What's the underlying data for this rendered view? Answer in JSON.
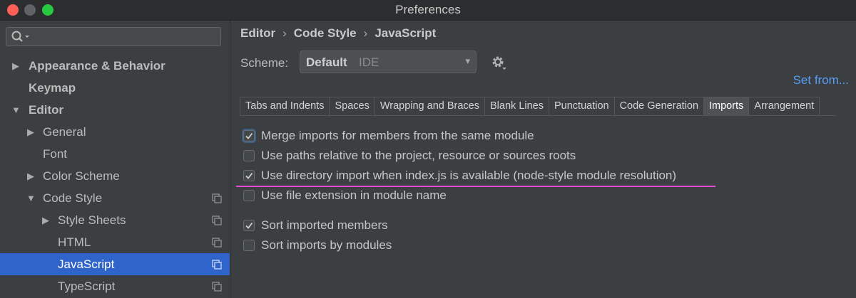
{
  "window": {
    "title": "Preferences"
  },
  "sidebar": {
    "search": {
      "value": "",
      "placeholder": ""
    },
    "items": [
      {
        "label": "Appearance & Behavior",
        "expandable": true,
        "expanded": false
      },
      {
        "label": "Keymap"
      },
      {
        "label": "Editor",
        "expandable": true,
        "expanded": true
      },
      {
        "label": "General",
        "expandable": true,
        "expanded": false
      },
      {
        "label": "Font"
      },
      {
        "label": "Color Scheme",
        "expandable": true,
        "expanded": false
      },
      {
        "label": "Code Style",
        "expandable": true,
        "expanded": true
      },
      {
        "label": "Style Sheets",
        "expandable": true,
        "expanded": false
      },
      {
        "label": "HTML"
      },
      {
        "label": "JavaScript",
        "selected": true
      },
      {
        "label": "TypeScript"
      }
    ]
  },
  "main": {
    "breadcrumb": [
      "Editor",
      "Code Style",
      "JavaScript"
    ],
    "breadcrumb_separator": "›",
    "scheme": {
      "label": "Scheme:",
      "name": "Default",
      "type": "IDE"
    },
    "set_from": "Set from...",
    "tabs": [
      {
        "label": "Tabs and Indents"
      },
      {
        "label": "Spaces"
      },
      {
        "label": "Wrapping and Braces"
      },
      {
        "label": "Blank Lines"
      },
      {
        "label": "Punctuation"
      },
      {
        "label": "Code Generation"
      },
      {
        "label": "Imports",
        "active": true
      },
      {
        "label": "Arrangement"
      }
    ],
    "options": [
      {
        "label": "Merge imports for members from the same module",
        "checked": true
      },
      {
        "label": "Use paths relative to the project, resource or sources roots",
        "checked": false
      },
      {
        "label": "Use directory import when index.js is available (node-style module resolution)",
        "checked": true
      },
      {
        "label": "Use file extension in module name",
        "checked": false
      },
      {
        "label": "Sort imported members",
        "checked": true
      },
      {
        "label": "Sort imports by modules",
        "checked": false
      }
    ]
  },
  "colors": {
    "selection": "#2f65ca",
    "link": "#589df6",
    "highlight_underline": "#e64bd8"
  }
}
